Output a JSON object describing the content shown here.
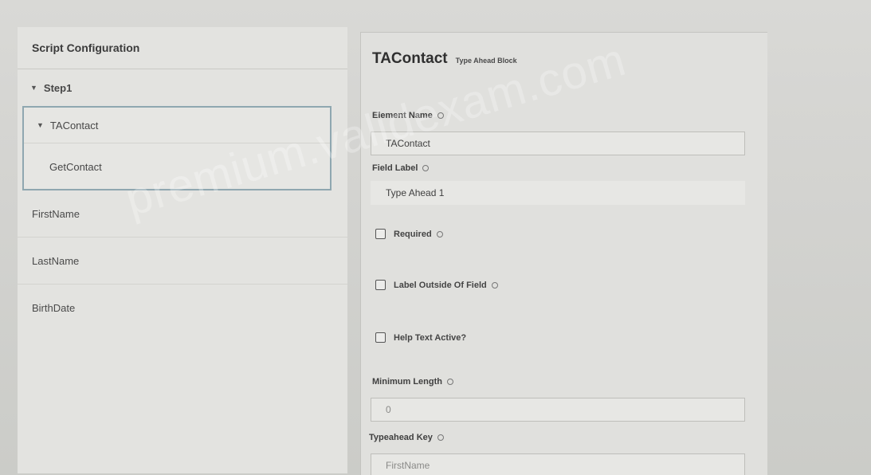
{
  "left_panel": {
    "header": "Script Configuration",
    "step_label": "Step1",
    "block_label": "TAContact",
    "block_child": "GetContact",
    "fields": [
      "FirstName",
      "LastName",
      "BirthDate"
    ]
  },
  "right_panel": {
    "title": "TAContact",
    "subtitle": "Type Ahead Block",
    "element_name_label": "Element Name",
    "element_name_value": "TAContact",
    "field_label_label": "Field Label",
    "field_label_value": "Type Ahead 1",
    "required_label": "Required",
    "label_outside_label": "Label Outside Of Field",
    "help_text_label": "Help Text Active?",
    "min_length_label": "Minimum Length",
    "min_length_value": "0",
    "typeahead_key_label": "Typeahead Key",
    "typeahead_key_value": "FirstName"
  },
  "watermark": "premium.validexam.com",
  "icons": {
    "expand": "chevron-down-icon",
    "info": "info-icon",
    "checkbox": "checkbox-unchecked"
  }
}
